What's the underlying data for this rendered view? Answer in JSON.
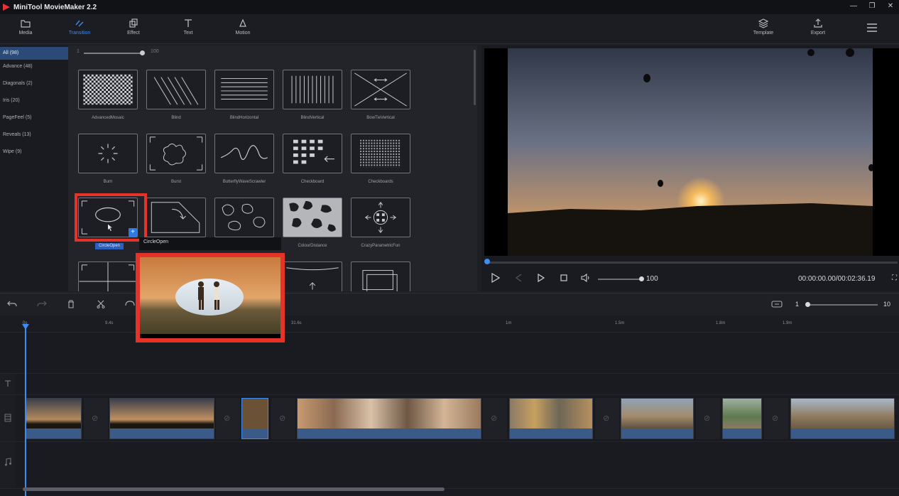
{
  "app": {
    "title": "MiniTool MovieMaker 2.2"
  },
  "toolbar": {
    "items": [
      {
        "label": "Media"
      },
      {
        "label": "Transition"
      },
      {
        "label": "Effect"
      },
      {
        "label": "Text"
      },
      {
        "label": "Motion"
      }
    ],
    "right": [
      {
        "label": "Template"
      },
      {
        "label": "Export"
      }
    ],
    "active": "Transition"
  },
  "categories": [
    {
      "label": "All (98)"
    },
    {
      "label": "Advance (48)"
    },
    {
      "label": "Diagonals (2)"
    },
    {
      "label": "Iris (20)"
    },
    {
      "label": "PageFeel (5)"
    },
    {
      "label": "Reveals (13)"
    },
    {
      "label": "Wipe (9)"
    }
  ],
  "zoom": {
    "min": "1",
    "max": "100"
  },
  "transitions": [
    {
      "label": "AdvancedMosaic"
    },
    {
      "label": "Blind"
    },
    {
      "label": "BlindHorizontal"
    },
    {
      "label": "BlindVertical"
    },
    {
      "label": "BowTieVertical"
    },
    {
      "label": "Burn"
    },
    {
      "label": "Burst"
    },
    {
      "label": "ButterflyWaveScrawler"
    },
    {
      "label": "Checkboard"
    },
    {
      "label": "Checkboards"
    },
    {
      "label": "CircleOpen"
    },
    {
      "label": "CircleOpen"
    },
    {
      "label": ""
    },
    {
      "label": "ColourDistance"
    },
    {
      "label": "CrazyParametricFun"
    }
  ],
  "player": {
    "volume": "100",
    "timecode": "00:00:00.00/00:02:36.19"
  },
  "timeline": {
    "zoom_min": "1",
    "zoom_max": "10",
    "ruler": [
      "0s",
      "9.4s",
      "31.6s",
      "1m",
      "1.5m",
      "1.8m",
      "1.9m"
    ]
  },
  "colors": {
    "accent": "#3f8cf0",
    "highlight": "#e5332a"
  }
}
